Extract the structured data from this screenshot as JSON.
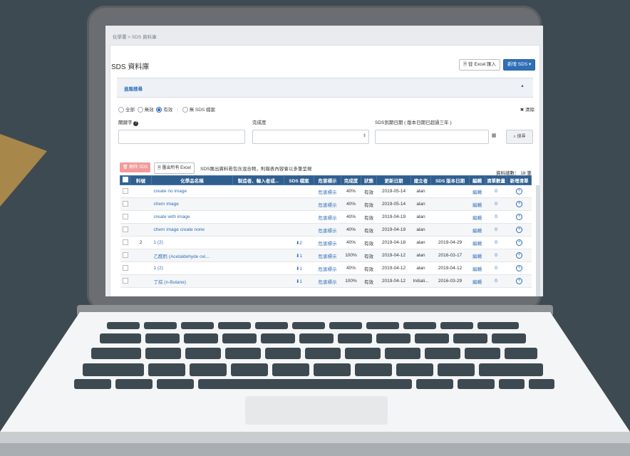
{
  "app": {
    "breadcrumb": "化學署 > SDS 資料庫",
    "page_title": "SDS 資料庫",
    "import_button": "從 Excel 匯入",
    "new_button": "新增 SDS ▾"
  },
  "advanced_search": {
    "label": "進階搜尋",
    "caret": "▲",
    "radio_options": [
      "全部",
      "無效",
      "有效"
    ],
    "selected": "有效",
    "no_sds_label": "無 SDS 檔案",
    "clear_label": "✖ 清除",
    "keyword_label": "關鍵字",
    "keyword_help_icon": "?",
    "completion_label": "完成度",
    "expiry_label": "SDS到期日期 ( 版本日期已超過三年 )",
    "search_button": "搜尋"
  },
  "toolbar": {
    "delete_button": "刪除 SDS",
    "export_button": "匯出所有 Excel",
    "export_note": "SDS匯出資料若包含混合物，則報表內容會以多筆呈現",
    "total_label": "資料總數： 18 筆"
  },
  "table": {
    "headers": [
      "料號",
      "化學品名稱",
      "製造者、輸入者或...",
      "SDS 檔案",
      "危害標示",
      "完成度",
      "狀態",
      "更新日期",
      "建立者",
      "SDS 版本日期",
      "編輯",
      "清單數量",
      "新增清單"
    ],
    "rows": [
      {
        "num": "",
        "name": "create no image",
        "maker": "",
        "sds": "",
        "hazard": "危害標示",
        "completion": "40%",
        "status": "有效",
        "updated": "2019-05-14",
        "creator": "alan",
        "version": "",
        "edit": "編輯",
        "count": "0"
      },
      {
        "num": "",
        "name": "chem image",
        "maker": "",
        "sds": "",
        "hazard": "危害標示",
        "completion": "40%",
        "status": "有效",
        "updated": "2019-05-14",
        "creator": "alan",
        "version": "",
        "edit": "編輯",
        "count": "0"
      },
      {
        "num": "",
        "name": "create with image",
        "maker": "",
        "sds": "",
        "hazard": "危害標示",
        "completion": "40%",
        "status": "有效",
        "updated": "2019-04-19",
        "creator": "alan",
        "version": "",
        "edit": "編輯",
        "count": "0"
      },
      {
        "num": "",
        "name": "chem image create none",
        "maker": "",
        "sds": "",
        "hazard": "危害標示",
        "completion": "40%",
        "status": "有效",
        "updated": "2019-04-19",
        "creator": "alan",
        "version": "",
        "edit": "編輯",
        "count": "0"
      },
      {
        "num": "2",
        "name": "1 (2)",
        "maker": "",
        "sds": "⬇2",
        "hazard": "危害標示",
        "completion": "40%",
        "status": "有效",
        "updated": "2019-04-18",
        "creator": "alan",
        "version": "2019-04-29",
        "edit": "編輯",
        "count": "0"
      },
      {
        "num": "",
        "name": "乙醛肟 (Acetaldehyde oxi...",
        "maker": "",
        "sds": "⬇1",
        "hazard": "危害標示",
        "completion": "100%",
        "status": "有效",
        "updated": "2019-04-12",
        "creator": "alan",
        "version": "2016-03-17",
        "edit": "編輯",
        "count": "0"
      },
      {
        "num": "",
        "name": "1 (2)",
        "maker": "",
        "sds": "⬇1",
        "hazard": "危害標示",
        "completion": "40%",
        "status": "有效",
        "updated": "2019-04-12",
        "creator": "alan",
        "version": "2019-04-12",
        "edit": "編輯",
        "count": "0"
      },
      {
        "num": "",
        "name": "丁烷 (n-Butane)",
        "maker": "",
        "sds": "⬇1",
        "hazard": "危害標示",
        "completion": "100%",
        "status": "有效",
        "updated": "2019-04-12",
        "creator": "Initiali...",
        "version": "2016-03-29",
        "edit": "編輯",
        "count": "0"
      }
    ]
  },
  "icons": {
    "trash": "trash-icon",
    "document": "document-icon",
    "calendar": "calendar-icon",
    "search": "search-icon",
    "plus": "plus-circle-icon"
  },
  "colors": {
    "background": "#3e4a52",
    "accent_triangle": "#a8874a",
    "primary": "#2f6fb7",
    "table_header": "#2f5f8f",
    "danger_button": "#f29b9b"
  }
}
